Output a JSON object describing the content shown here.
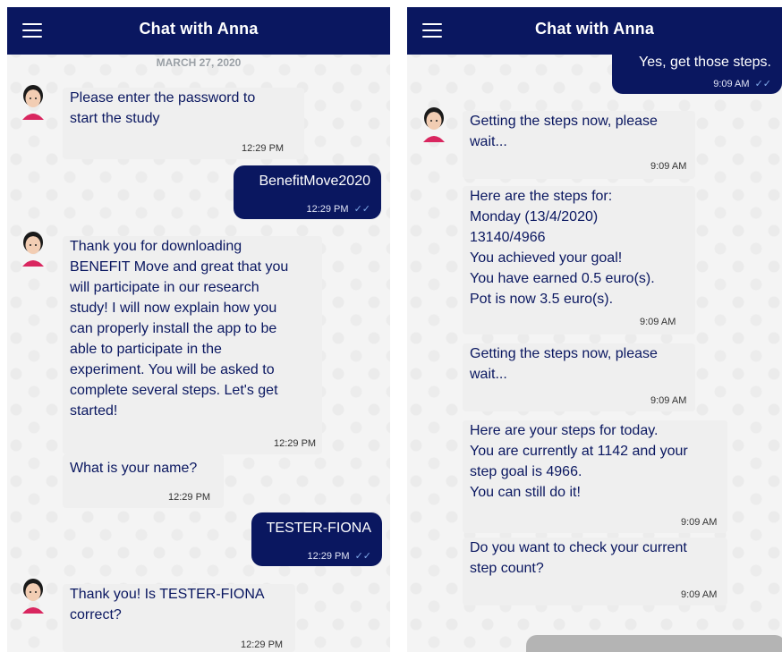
{
  "left": {
    "title": "Chat with Anna",
    "date": "MARCH 27, 2020",
    "messages": {
      "m1": {
        "text": "Please enter the password to\nstart the study",
        "time": "12:29 PM"
      },
      "u1": {
        "text": "BenefitMove2020",
        "time": "12:29 PM"
      },
      "m2": {
        "text": "Thank you for downloading\nBENEFIT Move and great that you\nwill participate in our research\nstudy! I will now explain how you\ncan properly install the app to be\nable to participate in the\nexperiment. You will be asked to\ncomplete several steps. Let's get\nstarted!",
        "time": "12:29 PM"
      },
      "m3": {
        "text": "What is your name?",
        "time": "12:29 PM"
      },
      "u2": {
        "text": "TESTER-FIONA",
        "time": "12:29 PM"
      },
      "m4": {
        "text": "Thank you! Is TESTER-FIONA\ncorrect?",
        "time": "12:29 PM"
      }
    }
  },
  "right": {
    "title": "Chat with Anna",
    "messages": {
      "u1": {
        "text": "Yes, get those steps.",
        "time": "9:09 AM"
      },
      "m1": {
        "text": "Getting the steps now, please\nwait...",
        "time": "9:09 AM"
      },
      "m2": {
        "text": "Here are the steps for:\nMonday (13/4/2020)\n13140/4966\nYou achieved your goal!\nYou have earned 0.5 euro(s).\nPot is now 3.5 euro(s).",
        "time": "9:09 AM"
      },
      "m3": {
        "text": "Getting the steps now, please\nwait...",
        "time": "9:09 AM"
      },
      "m4": {
        "text": "Here are your steps for today.\nYou are currently at 1142 and your\nstep goal is 4966.\nYou can still do it!",
        "time": "9:09 AM"
      },
      "m5": {
        "text": "Do you want to check your current\nstep count?",
        "time": "9:09 AM"
      }
    }
  },
  "icons": {
    "menu": "hamburger-menu-icon",
    "avatar": "anna-avatar-icon",
    "read": "double-check-icon"
  },
  "colors": {
    "header": "#0a1760",
    "user_bubble": "#0a1760",
    "bot_text": "#0a1760",
    "bot_bubble": "#efefef",
    "read_check": "#7fa8e8"
  }
}
